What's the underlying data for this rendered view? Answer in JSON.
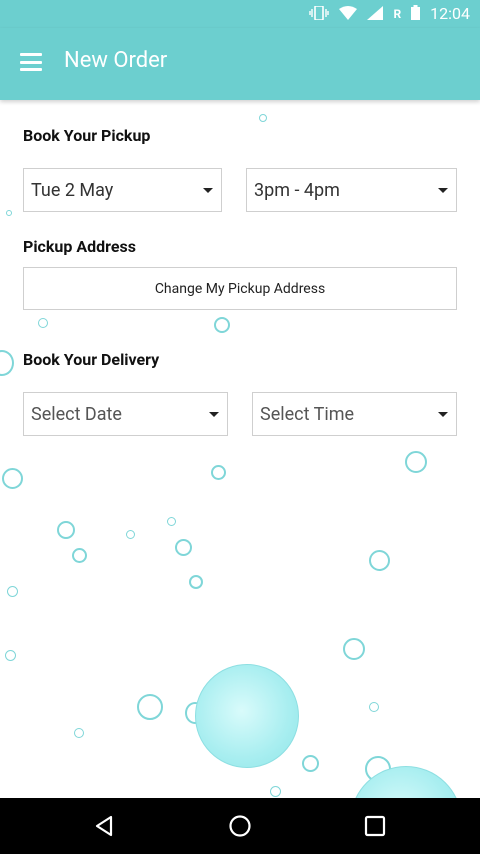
{
  "status_bar": {
    "time": "12:04",
    "roaming": "R"
  },
  "app_bar": {
    "title": "New Order"
  },
  "pickup": {
    "heading": "Book Your Pickup",
    "date": "Tue 2 May",
    "time": "3pm - 4pm"
  },
  "address": {
    "heading": "Pickup Address",
    "button_label": "Change My Pickup Address"
  },
  "delivery": {
    "heading": "Book Your Delivery",
    "date_placeholder": "Select Date",
    "time_placeholder": "Select Time"
  },
  "colors": {
    "primary": "#6ccfcf",
    "bubble": "#7fd6d8"
  }
}
